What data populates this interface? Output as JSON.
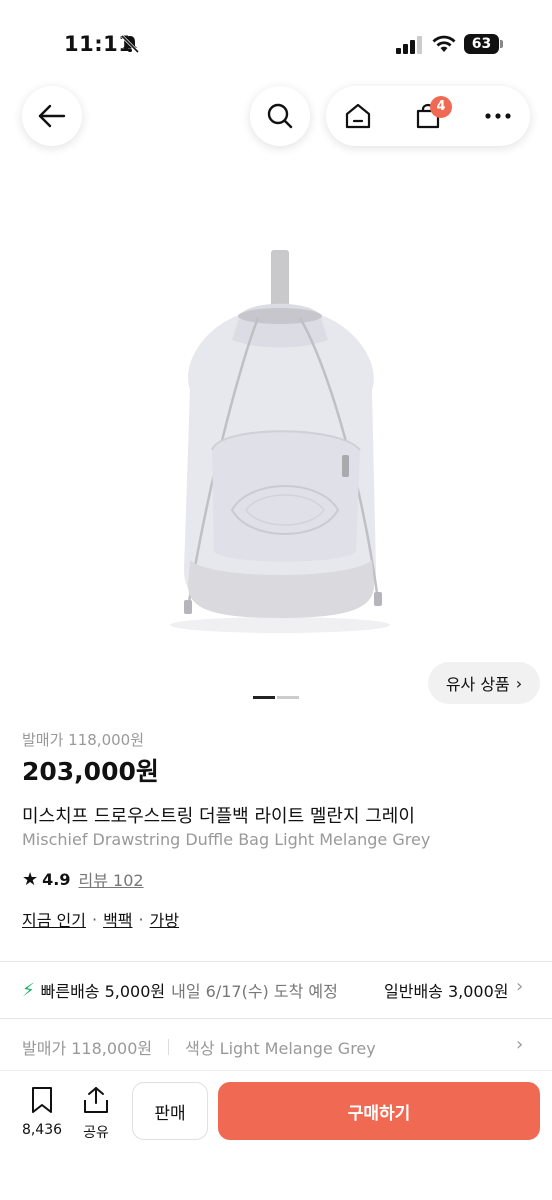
{
  "status_bar": {
    "time": "11:11",
    "battery": "63"
  },
  "header": {
    "cart_count": "4"
  },
  "similar": {
    "label": "유사 상품"
  },
  "product": {
    "list_price": "발매가 118,000원",
    "sale_price": "203,000원",
    "title_ko": "미스치프 드로우스트링 더플백 라이트 멜란지 그레이",
    "title_en": "Mischief Drawstring Duffle Bag Light Melange Grey",
    "rating": "4.9",
    "review": "리뷰 102",
    "tags": [
      "지금 인기",
      "백팩",
      "가방"
    ]
  },
  "shipping": {
    "fast_label": "빠른배송 5,000원",
    "fast_eta": "내일 6/17(수) 도착 예정",
    "normal_label": "일반배송 3,000원"
  },
  "options": {
    "release_price": "발매가 118,000원",
    "color": "색상 Light Melange Grey"
  },
  "bottom_bar": {
    "save_count": "8,436",
    "share_label": "공유",
    "sell_label": "판매",
    "buy_label": "구매하기"
  },
  "colors": {
    "accent": "#f06a53",
    "fast_ship": "#18b46b"
  }
}
